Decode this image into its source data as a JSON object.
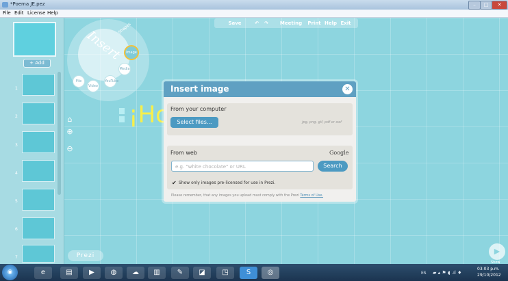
{
  "window": {
    "title": "*Poema JE.pez",
    "minimize": "–",
    "maximize": "□",
    "close": "✕"
  },
  "menu": [
    "File",
    "Edit",
    "License",
    "Help"
  ],
  "toolbar": {
    "save": "Save",
    "undo": "↶",
    "redo": "↷",
    "meeting": "Meeting",
    "print": "Print",
    "help": "Help",
    "exit": "Exit"
  },
  "left_panel": {
    "add_label": "+ Add",
    "thumbnails": [
      {
        "num": "1",
        "text": ""
      },
      {
        "num": "2",
        "text": ""
      },
      {
        "num": "3",
        "text": ""
      },
      {
        "num": "4",
        "text": ""
      },
      {
        "num": "5",
        "text": ""
      },
      {
        "num": "6",
        "text": ""
      },
      {
        "num": "7",
        "text": ""
      }
    ]
  },
  "zoom": {
    "home": "⌂",
    "in": "⊕",
    "out": "⊖"
  },
  "wheel": {
    "insert_label": "Insert",
    "shapes_label": "Shapes",
    "image_label": "Image",
    "items": [
      "File",
      "Video",
      "YouTube",
      "Media"
    ]
  },
  "canvas": {
    "heading": "¡Hol"
  },
  "prezi_logo": "Prezi",
  "show_label": "Show",
  "dialog": {
    "title": "Insert image",
    "computer_label": "From your computer",
    "select_files": "Select files...",
    "file_hint": "jpg, png, gif, pdf or swf",
    "web_label": "From web",
    "google_label": "Google",
    "search_placeholder": "e.g. \"white chocolate\" or URL",
    "search_button": "Search",
    "license_check": "✔",
    "license_text": "Show only images pre-licensed for use in Prezi.",
    "remember_text": "Please remember, that any images you upload must comply with the Prezi",
    "terms_text": "Terms of Use."
  },
  "taskbar": {
    "start": "◉",
    "apps": [
      "e",
      "▤",
      "▶",
      "◍",
      "☁",
      "▥",
      "✎",
      "◪",
      "◳",
      "S",
      "◎"
    ],
    "lang": "ES",
    "tray": "▰ ▴ ⚑ ◖ .ıl ♦",
    "time": "03:03 p.m.",
    "date": "29/10/2012"
  },
  "colors": {
    "canvas": "#8dd5df",
    "dialog_header": "#5fa0c2",
    "button": "#4c9ac2",
    "heading": "#f7ef4a",
    "image_highlight": "#f2c23a"
  }
}
